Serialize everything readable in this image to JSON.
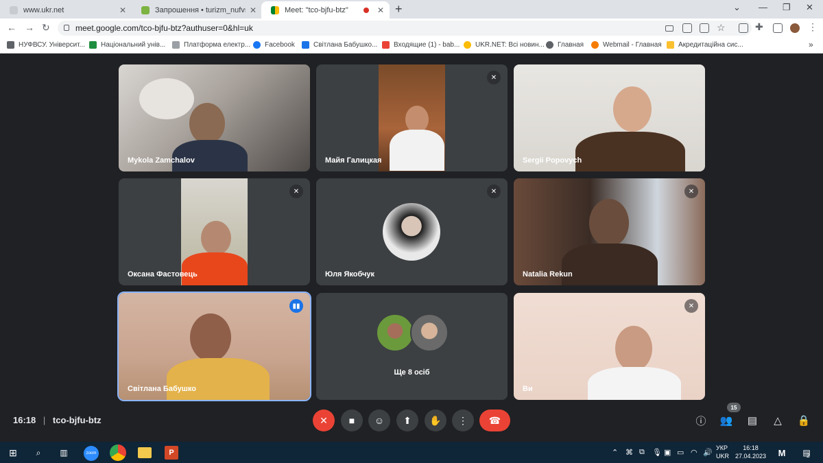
{
  "browser": {
    "tabs": [
      {
        "title": "www.ukr.net",
        "active": false
      },
      {
        "title": "Запрошення • turizm_nufvsu@u",
        "active": false
      },
      {
        "title": "Meet: \"tco-bjfu-btz\"",
        "active": true
      }
    ],
    "url": "meet.google.com/tco-bjfu-btz?authuser=0&hl=uk",
    "bookmarks": [
      "НУФВСУ. Університ...",
      "Національний унів...",
      "Платформа електр...",
      "Facebook",
      "Світлана Бабушко...",
      "Входящие (1) - bab...",
      "UKR.NET: Всі новин...",
      "Главная",
      "Webmail - Главная",
      "Акредитаційна сис..."
    ],
    "more": "»"
  },
  "meet": {
    "participants": [
      {
        "name": "Mykola Zamchalov",
        "muted": false
      },
      {
        "name": "Майя Галицкая",
        "muted": true
      },
      {
        "name": "Sergii Popovych",
        "muted": false
      },
      {
        "name": "Оксана Фастовець",
        "muted": true
      },
      {
        "name": "Юля Якобчук",
        "muted": true
      },
      {
        "name": "Natalia Rekun",
        "muted": true
      },
      {
        "name": "Світлана Бабушко",
        "muted": false,
        "speaking": true
      },
      {
        "name": "Ще 8 осіб",
        "muted": false
      },
      {
        "name": "Ви",
        "muted": true
      }
    ],
    "more_label": "Ще 8 осіб",
    "time": "16:18",
    "separator": "|",
    "meeting_code": "tco-bjfu-btz",
    "participant_count": "15"
  },
  "taskbar": {
    "lang_top": "УКР",
    "lang_bottom": "UKR",
    "time": "16:18",
    "date": "27.04.2023",
    "notif_count": "2",
    "zoom_label": "zoom"
  },
  "colors": {
    "background": "#202124",
    "tile": "#3c4043",
    "end_call": "#ea4335",
    "speaking": "#8ab4f8",
    "taskbar": "#0f2538"
  }
}
